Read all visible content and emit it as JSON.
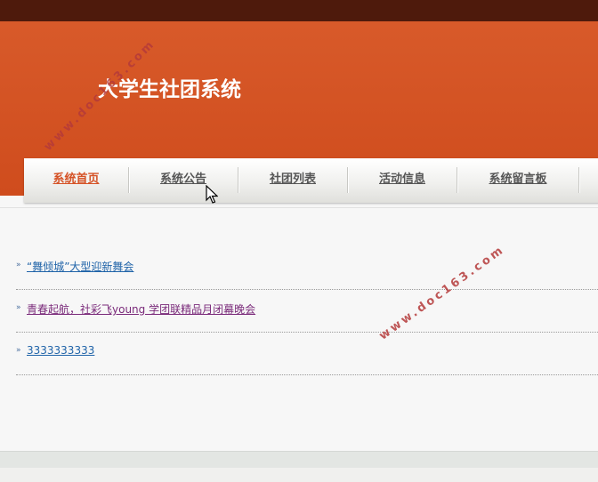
{
  "site": {
    "title": "大学生社团系统"
  },
  "nav": {
    "items": [
      {
        "label": "系统首页",
        "active": true
      },
      {
        "label": "系统公告"
      },
      {
        "label": "社团列表"
      },
      {
        "label": "活动信息"
      },
      {
        "label": "系统留言板"
      }
    ]
  },
  "news": {
    "items": [
      {
        "title": "“舞倾城”大型迎新舞会"
      },
      {
        "title": "青春起航，社彩飞young 学团联精品月闭幕晚会"
      },
      {
        "title": "3333333333"
      }
    ]
  },
  "watermark": {
    "text": "www.doc163.com"
  },
  "colors": {
    "banner": "#cf4c1d",
    "topbar": "#4e1a0c",
    "accent": "#d55226",
    "link": "#1f63a8"
  }
}
